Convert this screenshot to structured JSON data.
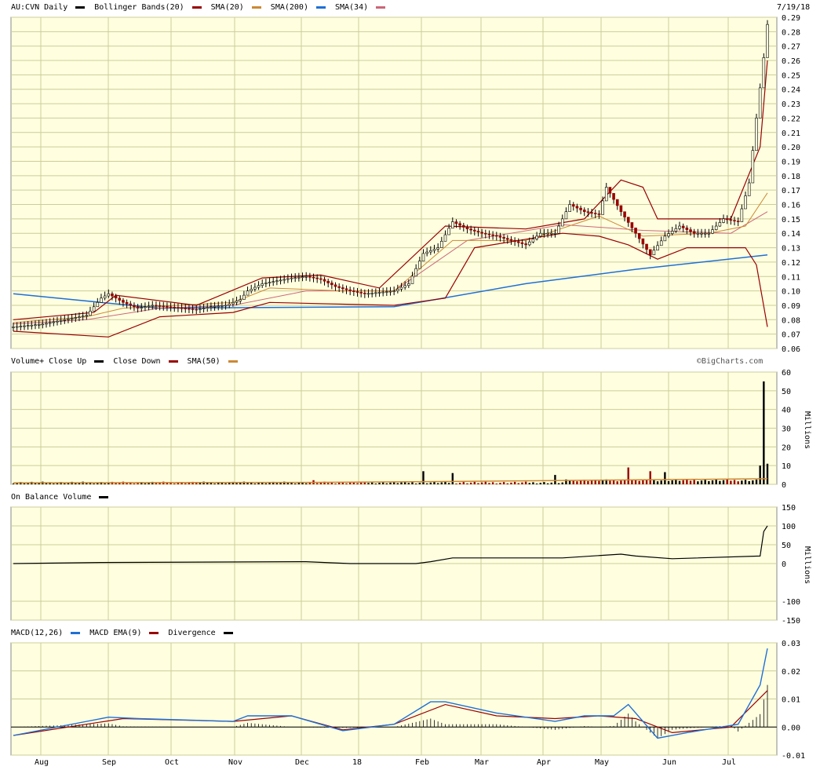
{
  "header": {
    "symbol": "AU:CVN Daily",
    "date": "7/19/18",
    "watermark": "©BigCharts.com"
  },
  "legends": {
    "price": [
      {
        "label": "AU:CVN Daily",
        "color": "#000000"
      },
      {
        "label": "Bollinger Bands(20)",
        "color": "#990000"
      },
      {
        "label": "SMA(20)",
        "color": "#cc8833"
      },
      {
        "label": "SMA(200)",
        "color": "#1f6fd6"
      },
      {
        "label": "SMA(34)",
        "color": "#cc6677"
      }
    ],
    "volume": [
      {
        "label": "Volume+ Close Up",
        "color": "#000000"
      },
      {
        "label": "Close Down",
        "color": "#990000"
      },
      {
        "label": "SMA(50)",
        "color": "#cc8833"
      }
    ],
    "obv": [
      {
        "label": "On Balance Volume",
        "color": "#000000"
      }
    ],
    "macd": [
      {
        "label": "MACD(12,26)",
        "color": "#1f6fd6"
      },
      {
        "label": "MACD EMA(9)",
        "color": "#990000"
      },
      {
        "label": "Divergence",
        "color": "#000000"
      }
    ]
  },
  "x_axis": {
    "months": [
      "Aug",
      "Sep",
      "Oct",
      "Nov",
      "Dec",
      "18",
      "Feb",
      "Mar",
      "Apr",
      "May",
      "Jun",
      "Jul"
    ]
  },
  "chart_data": [
    {
      "type": "line",
      "name": "price",
      "ylim": [
        0.06,
        0.29
      ],
      "yticks": [
        "0.06",
        "0.07",
        "0.08",
        "0.09",
        "0.10",
        "0.11",
        "0.12",
        "0.13",
        "0.14",
        "0.15",
        "0.16",
        "0.17",
        "0.18",
        "0.19",
        "0.20",
        "0.21",
        "0.22",
        "0.23",
        "0.24",
        "0.25",
        "0.26",
        "0.27",
        "0.28",
        "0.29"
      ],
      "close_points": [
        [
          0,
          0.075
        ],
        [
          4,
          0.076
        ],
        [
          8,
          0.077
        ],
        [
          12,
          0.079
        ],
        [
          16,
          0.081
        ],
        [
          20,
          0.083
        ],
        [
          24,
          0.095
        ],
        [
          26,
          0.098
        ],
        [
          30,
          0.092
        ],
        [
          34,
          0.088
        ],
        [
          38,
          0.09
        ],
        [
          42,
          0.089
        ],
        [
          46,
          0.088
        ],
        [
          50,
          0.087
        ],
        [
          54,
          0.089
        ],
        [
          58,
          0.09
        ],
        [
          62,
          0.094
        ],
        [
          64,
          0.1
        ],
        [
          68,
          0.105
        ],
        [
          72,
          0.107
        ],
        [
          76,
          0.109
        ],
        [
          80,
          0.11
        ],
        [
          84,
          0.108
        ],
        [
          88,
          0.103
        ],
        [
          92,
          0.1
        ],
        [
          96,
          0.098
        ],
        [
          100,
          0.099
        ],
        [
          104,
          0.1
        ],
        [
          108,
          0.105
        ],
        [
          112,
          0.126
        ],
        [
          116,
          0.13
        ],
        [
          120,
          0.148
        ],
        [
          124,
          0.143
        ],
        [
          128,
          0.14
        ],
        [
          132,
          0.138
        ],
        [
          136,
          0.135
        ],
        [
          140,
          0.132
        ],
        [
          144,
          0.14
        ],
        [
          148,
          0.14
        ],
        [
          152,
          0.16
        ],
        [
          156,
          0.155
        ],
        [
          160,
          0.153
        ],
        [
          162,
          0.172
        ],
        [
          166,
          0.155
        ],
        [
          170,
          0.14
        ],
        [
          174,
          0.125
        ],
        [
          178,
          0.138
        ],
        [
          182,
          0.145
        ],
        [
          186,
          0.14
        ],
        [
          190,
          0.14
        ],
        [
          194,
          0.15
        ],
        [
          198,
          0.148
        ],
        [
          201,
          0.175
        ],
        [
          203,
          0.22
        ],
        [
          205,
          0.262
        ],
        [
          206,
          0.285
        ]
      ],
      "sma20": [
        [
          0,
          0.078
        ],
        [
          20,
          0.082
        ],
        [
          30,
          0.088
        ],
        [
          60,
          0.092
        ],
        [
          70,
          0.102
        ],
        [
          90,
          0.1
        ],
        [
          104,
          0.1
        ],
        [
          120,
          0.135
        ],
        [
          140,
          0.135
        ],
        [
          160,
          0.152
        ],
        [
          172,
          0.138
        ],
        [
          190,
          0.14
        ],
        [
          200,
          0.145
        ],
        [
          206,
          0.168
        ]
      ],
      "sma34": [
        [
          0,
          0.077
        ],
        [
          20,
          0.08
        ],
        [
          40,
          0.088
        ],
        [
          60,
          0.09
        ],
        [
          80,
          0.1
        ],
        [
          104,
          0.1
        ],
        [
          124,
          0.135
        ],
        [
          150,
          0.146
        ],
        [
          172,
          0.142
        ],
        [
          196,
          0.14
        ],
        [
          206,
          0.155
        ]
      ],
      "sma200": [
        [
          0,
          0.098
        ],
        [
          40,
          0.088
        ],
        [
          104,
          0.089
        ],
        [
          140,
          0.105
        ],
        [
          170,
          0.115
        ],
        [
          206,
          0.125
        ]
      ],
      "bb_upper": [
        [
          0,
          0.08
        ],
        [
          22,
          0.085
        ],
        [
          28,
          0.097
        ],
        [
          50,
          0.09
        ],
        [
          68,
          0.109
        ],
        [
          84,
          0.111
        ],
        [
          100,
          0.102
        ],
        [
          118,
          0.145
        ],
        [
          140,
          0.143
        ],
        [
          156,
          0.15
        ],
        [
          166,
          0.177
        ],
        [
          172,
          0.172
        ],
        [
          176,
          0.15
        ],
        [
          196,
          0.15
        ],
        [
          204,
          0.2
        ],
        [
          206,
          0.26
        ]
      ],
      "bb_lower": [
        [
          0,
          0.072
        ],
        [
          26,
          0.068
        ],
        [
          40,
          0.082
        ],
        [
          60,
          0.085
        ],
        [
          70,
          0.092
        ],
        [
          104,
          0.09
        ],
        [
          118,
          0.095
        ],
        [
          126,
          0.13
        ],
        [
          150,
          0.14
        ],
        [
          160,
          0.138
        ],
        [
          168,
          0.132
        ],
        [
          176,
          0.122
        ],
        [
          184,
          0.13
        ],
        [
          200,
          0.13
        ],
        [
          203,
          0.118
        ],
        [
          206,
          0.075
        ]
      ]
    },
    {
      "type": "bar",
      "name": "volume",
      "unit": "Millions",
      "ylim": [
        0,
        60
      ],
      "yticks": [
        "0",
        "10",
        "20",
        "30",
        "40",
        "50",
        "60"
      ],
      "spikes": [
        [
          82,
          2.2
        ],
        [
          112,
          7
        ],
        [
          120,
          6
        ],
        [
          148,
          5
        ],
        [
          168,
          9
        ],
        [
          174,
          7
        ],
        [
          178,
          6.5
        ],
        [
          204,
          10
        ],
        [
          205,
          55
        ],
        [
          206,
          11
        ]
      ]
    },
    {
      "type": "line",
      "name": "obv",
      "unit": "Millions",
      "ylim": [
        -150,
        150
      ],
      "yticks": [
        "150",
        "100",
        "50",
        "0",
        "-100",
        "-150"
      ],
      "points": [
        [
          0,
          0
        ],
        [
          24,
          3
        ],
        [
          80,
          5
        ],
        [
          92,
          0
        ],
        [
          110,
          0
        ],
        [
          114,
          5
        ],
        [
          120,
          15
        ],
        [
          150,
          15
        ],
        [
          166,
          25
        ],
        [
          170,
          20
        ],
        [
          180,
          13
        ],
        [
          204,
          20
        ],
        [
          205,
          85
        ],
        [
          206,
          100
        ]
      ]
    },
    {
      "type": "line",
      "name": "macd",
      "ylim": [
        -0.01,
        0.03
      ],
      "yticks": [
        "0.03",
        "0.02",
        "0.01",
        "0.00",
        "-0.01"
      ],
      "macd": [
        [
          0,
          -0.003
        ],
        [
          26,
          0.0035
        ],
        [
          34,
          0.003
        ],
        [
          60,
          0.002
        ],
        [
          64,
          0.004
        ],
        [
          76,
          0.004
        ],
        [
          90,
          -0.0013
        ],
        [
          104,
          0.001
        ],
        [
          114,
          0.009
        ],
        [
          118,
          0.009
        ],
        [
          132,
          0.005
        ],
        [
          148,
          0.002
        ],
        [
          156,
          0.004
        ],
        [
          164,
          0.004
        ],
        [
          168,
          0.008
        ],
        [
          176,
          -0.004
        ],
        [
          184,
          -0.002
        ],
        [
          198,
          0.001
        ],
        [
          204,
          0.015
        ],
        [
          206,
          0.028
        ]
      ],
      "signal": [
        [
          0,
          -0.003
        ],
        [
          30,
          0.003
        ],
        [
          60,
          0.002
        ],
        [
          76,
          0.004
        ],
        [
          90,
          -0.001
        ],
        [
          104,
          0.001
        ],
        [
          118,
          0.008
        ],
        [
          132,
          0.004
        ],
        [
          148,
          0.003
        ],
        [
          160,
          0.004
        ],
        [
          170,
          0.003
        ],
        [
          180,
          -0.002
        ],
        [
          196,
          0.0
        ],
        [
          206,
          0.013
        ]
      ]
    }
  ]
}
